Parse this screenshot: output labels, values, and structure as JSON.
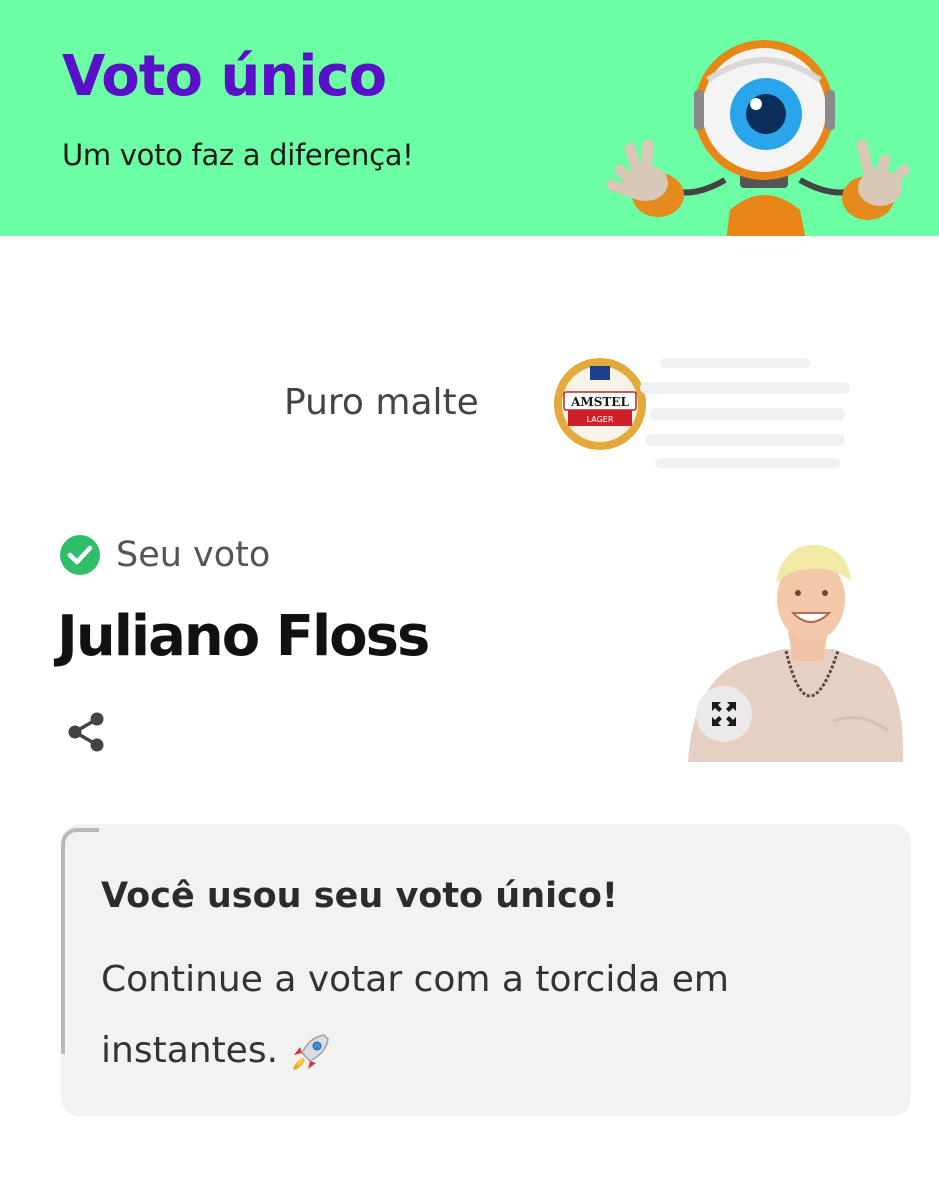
{
  "header": {
    "title": "Voto único",
    "subtitle": "Um voto faz a diferença!",
    "background_color": "#6bfea4",
    "title_color": "#5a0fc8",
    "mascot_icon": "big-brother-eye-robot-mascot"
  },
  "sponsor": {
    "label": "Puro malte",
    "logo_text": "AMSTEL",
    "logo_subtext": "LAGER"
  },
  "vote": {
    "status_label": "Seu voto",
    "status_icon": "check-circle-icon",
    "status_color": "#2fbf6b",
    "candidate_name": "Juliano Floss",
    "share_icon": "share-icon",
    "expand_icon": "expand-icon"
  },
  "notice": {
    "title": "Você usou seu voto único!",
    "body": "Continue a votar com a torcida em instantes.",
    "emoji_icon": "rocket-icon"
  }
}
